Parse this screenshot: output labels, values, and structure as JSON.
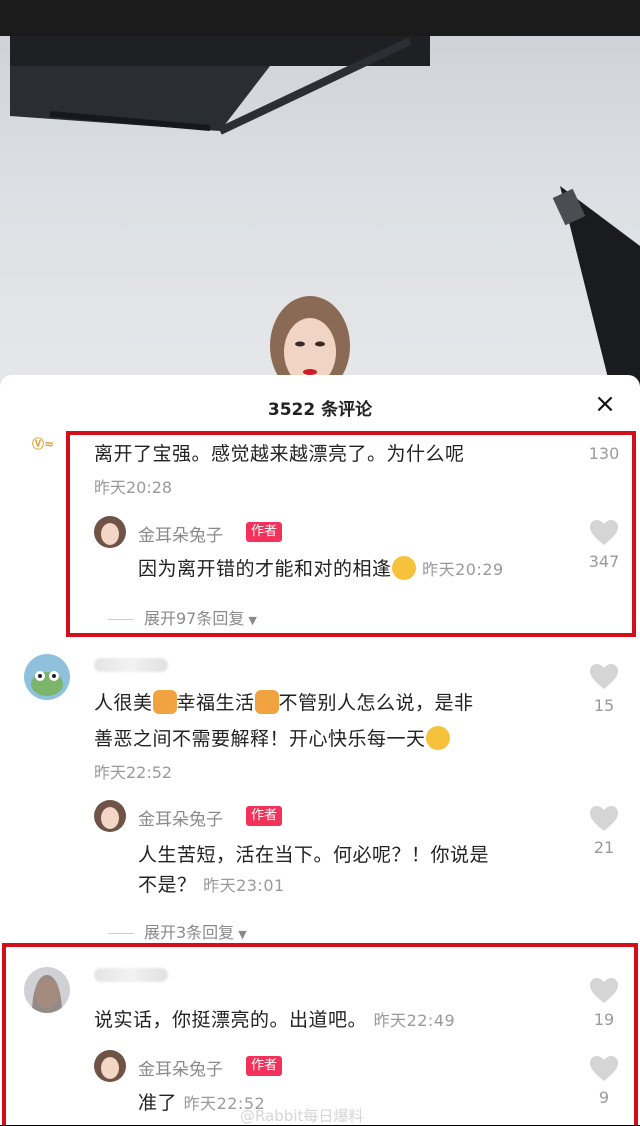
{
  "sheet": {
    "title": "3522 条评论",
    "close_icon": "×"
  },
  "comments": [
    {
      "text": "离开了宝强。感觉越来越漂亮了。为什么呢",
      "time": "昨天20:28",
      "likes": "130",
      "reply": {
        "name": "金耳朵兔子",
        "badge": "作者",
        "text": "因为离开错的才能和对的相逢",
        "time": "昨天20:29",
        "likes": "347"
      },
      "expand": "展开97条回复"
    },
    {
      "text_line1": "人很美",
      "text_line1b": "幸福生活",
      "text_line1c": "不管别人怎么说，是非",
      "text_line2": "善恶之间不需要解释！开心快乐每一天",
      "time": "昨天22:52",
      "likes": "15",
      "reply": {
        "name": "金耳朵兔子",
        "badge": "作者",
        "text_line1": "人生苦短，活在当下。何必呢？！你说是",
        "text_line2": "不是？",
        "time": "昨天23:01",
        "likes": "21"
      },
      "expand": "展开3条回复"
    },
    {
      "text": "说实话，你挺漂亮的。出道吧。",
      "time": "昨天22:49",
      "likes": "19",
      "reply": {
        "name": "金耳朵兔子",
        "badge": "作者",
        "text": "准了",
        "time": "昨天22:52",
        "likes": "9"
      }
    }
  ],
  "watermark": "@Rabbit每日爆料",
  "colors": {
    "highlight": "#d20f1a",
    "badge": "#f2325a"
  }
}
